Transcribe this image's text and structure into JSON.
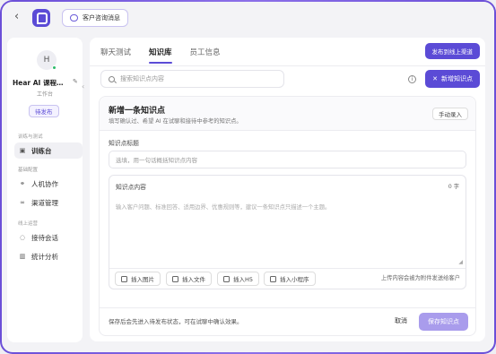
{
  "topbar": {
    "chip_label": "客户咨询消息"
  },
  "sidebar": {
    "avatar_letter": "H",
    "agent_name": "Hear AI 课程…",
    "agent_role": "工作台",
    "status_badge": "待发布",
    "groups": [
      {
        "label": "训练与测试",
        "items": [
          {
            "label": "训练台",
            "icon": "train-icon",
            "active": true
          }
        ]
      },
      {
        "label": "基础配置",
        "items": [
          {
            "label": "人机协作",
            "icon": "handshake-icon"
          },
          {
            "label": "渠道管理",
            "icon": "link-icon"
          }
        ]
      },
      {
        "label": "线上运营",
        "items": [
          {
            "label": "接待会话",
            "icon": "chat-icon"
          },
          {
            "label": "统计分析",
            "icon": "chart-icon"
          }
        ]
      }
    ]
  },
  "main": {
    "tabs": [
      {
        "label": "聊天测试"
      },
      {
        "label": "知识库",
        "active": true
      },
      {
        "label": "员工信息"
      }
    ],
    "publish_button": "发布到线上渠道",
    "search_placeholder": "搜索知识点内容",
    "new_button": "新增知识点",
    "form": {
      "title": "新增一条知识点",
      "subtitle": "填写确认过、希望 AI 在试聊和接待中参考的知识点。",
      "manual_button": "手动录入",
      "title_field_label": "知识点标题",
      "title_placeholder": "选填，用一句话概括知识点内容",
      "content_label": "知识点内容",
      "char_count": "0 字",
      "content_placeholder": "输入客户问题、标准回答、适用边界、优惠规则等，建议一条知识点只描述一个主题。",
      "toolbar": [
        {
          "label": "插入图片",
          "icon": "image-icon"
        },
        {
          "label": "插入文件",
          "icon": "file-icon"
        },
        {
          "label": "插入H5",
          "icon": "link-icon"
        },
        {
          "label": "插入小程序",
          "icon": "miniprogram-icon"
        }
      ],
      "upload_note": "上传内容会被为附件发送给客户",
      "footer_note": "保存后会先进入待发布状态，可在试聊中确认效果。",
      "cancel_button": "取消",
      "save_button": "保存知识点"
    }
  },
  "colors": {
    "accent": "#5b4bd6",
    "save_disabled": "#a99cec",
    "online_dot": "#2dbb6a"
  }
}
